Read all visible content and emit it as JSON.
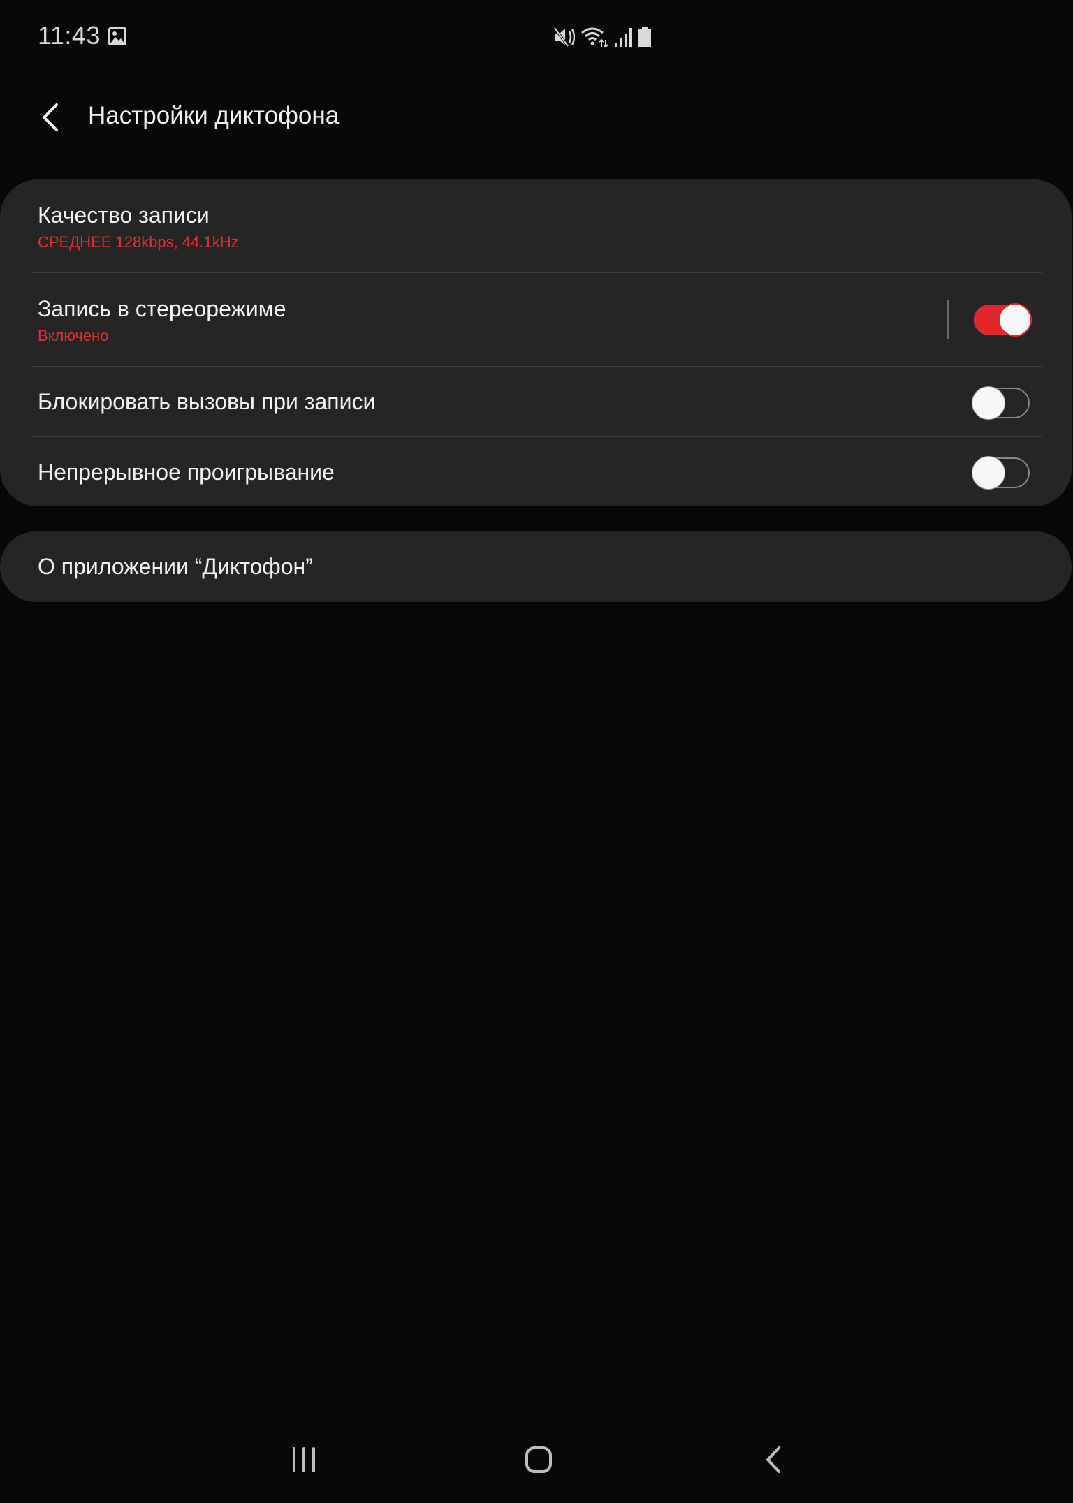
{
  "status_bar": {
    "time": "11:43",
    "icons": [
      "gallery-icon",
      "mute-icon",
      "wifi-icon",
      "signal-icon",
      "battery-icon"
    ]
  },
  "app_bar": {
    "title": "Настройки диктофона",
    "back_icon": "chevron-left-icon"
  },
  "settings": {
    "items": [
      {
        "title": "Качество записи",
        "subtitle": "СРЕДНЕЕ 128kbps, 44.1kHz"
      },
      {
        "title": "Запись в стереорежиме",
        "subtitle": "Включено",
        "toggle": true
      },
      {
        "title": "Блокировать вызовы при записи",
        "toggle": false
      },
      {
        "title": "Непрерывное проигрывание",
        "toggle": false
      }
    ]
  },
  "about": {
    "title": "О приложении “Диктофон”"
  },
  "nav_bar": {
    "icons": [
      "recent-apps-icon",
      "home-icon",
      "back-icon"
    ]
  },
  "colors": {
    "background": "#080808",
    "card": "#252525",
    "accent": "#e3272b",
    "text": "#f2f2f2",
    "subtitle": "#e0322f"
  }
}
